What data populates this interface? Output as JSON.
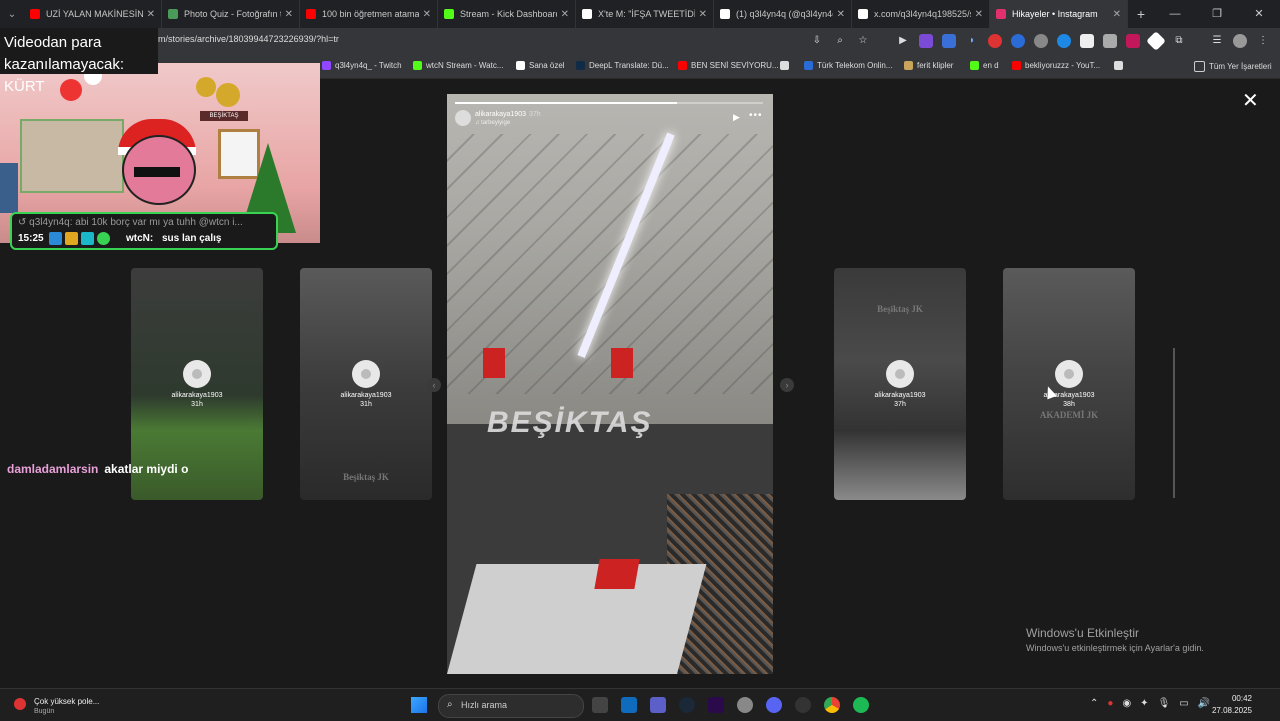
{
  "tabs": [
    {
      "title": "UZİ YALAN MAKİNESİNDE",
      "color": "#ff0000",
      "active": false
    },
    {
      "title": "Photo Quiz - Fotoğrafın t...",
      "color": "#4a9a5a",
      "active": false
    },
    {
      "title": "100 bin öğretmen atama",
      "color": "#ff0000",
      "active": false
    },
    {
      "title": "Stream - Kick Dashboard",
      "color": "#53fc18",
      "active": false
    },
    {
      "title": "X'te M: \"İFŞA TWEETİDİR",
      "color": "#ffffff",
      "active": false
    },
    {
      "title": "(1) q3l4yn4q (@q3l4yn4q",
      "color": "#ffffff",
      "active": false
    },
    {
      "title": "x.com/q3l4yn4q198525/s",
      "color": "#ffffff",
      "active": false
    },
    {
      "title": "Hikayeler • Instagram",
      "color": "#e1306c",
      "active": true
    }
  ],
  "address": {
    "url": "m/stories/archive/18039944723226939/?hl=tr"
  },
  "bookmarks": [
    {
      "label": "q3l4yn4q_ - Twitch",
      "color": "#9146ff"
    },
    {
      "label": "wtcN Stream - Watc...",
      "color": "#53fc18"
    },
    {
      "label": "Sana özel",
      "color": "#ffffff"
    },
    {
      "label": "DeepL Translate: Dü...",
      "color": "#0f2b46"
    },
    {
      "label": "BEN SENİ SEVİYORU...",
      "color": "#ff0000"
    },
    {
      "label": "",
      "color": "#dddddd"
    },
    {
      "label": "Türk Telekom Onlin...",
      "color": "#2a6bd6"
    },
    {
      "label": "ferit klipler",
      "color": "#c9a45a"
    },
    {
      "label": "en d",
      "color": "#53fc18"
    },
    {
      "label": "bekliyoruzzz - YouT...",
      "color": "#ff0000"
    },
    {
      "label": "",
      "color": "#dddddd"
    }
  ],
  "bookmarks_all": "Tüm Yer İşaretleri",
  "overlay": {
    "title": "Videodan para kazanılamayacak: KÜRT",
    "sign": "BEŞİKTAŞ",
    "chat_reply": "↺ q3l4yn4q: abi 10k borç var mı ya tuhh @wtcn i...",
    "chat_time": "15:25",
    "chat_user": "wtcN:",
    "chat_msg": "sus lan çalış",
    "chatline_user": "damladamlarsin",
    "chatline_msg": "akatlar miydi o"
  },
  "story": {
    "username": "alikarakaya1903",
    "time": "37h",
    "subtitle": "♫ tarbeyiyige",
    "wordmark": "BEŞİKTAŞ",
    "progress_fraction": 0.72
  },
  "cards": [
    {
      "username": "alikarakaya1903",
      "time": "31h",
      "brand": ""
    },
    {
      "username": "alikarakaya1903",
      "time": "31h",
      "brand": "Beşiktaş JK"
    },
    {
      "username": "alikarakaya1903",
      "time": "37h",
      "brand": "Beşiktaş JK"
    },
    {
      "username": "alikarakaya1903",
      "time": "38h",
      "brand": "AKADEMİ JK"
    }
  ],
  "watermark": {
    "line1": "Windows'u Etkinleştir",
    "line2": "Windows'u etkinleştirmek için Ayarlar'a gidin."
  },
  "taskbar": {
    "notif_title": "Çok yüksek pole...",
    "notif_sub": "Bugün",
    "search_placeholder": "Hızlı arama",
    "time": "00:42",
    "date": "27.08.2025"
  }
}
